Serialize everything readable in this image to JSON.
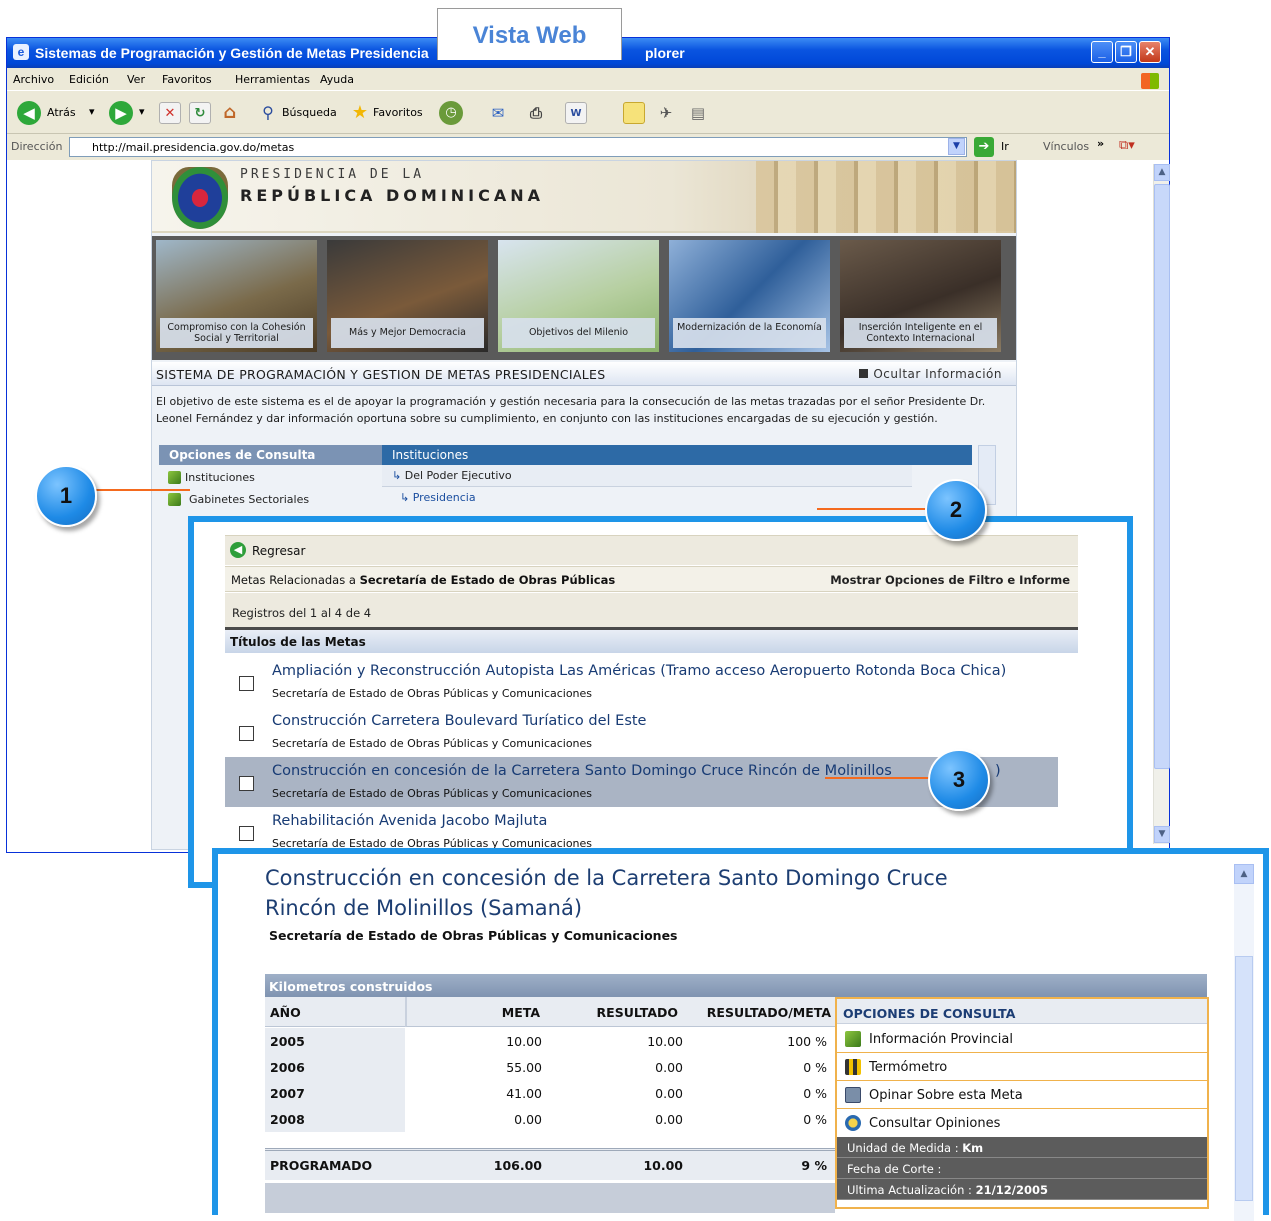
{
  "vista_label": "Vista Web",
  "browser": {
    "title": "Sistemas de Programación y Gestión de Metas Presidencia",
    "title_tail": "plorer",
    "menu": [
      "Archivo",
      "Edición",
      "Ver",
      "Favoritos",
      "Herramientas",
      "Ayuda"
    ],
    "toolbar": {
      "back": "Atrás",
      "search": "Búsqueda",
      "favorites": "Favoritos"
    },
    "address_label": "Dirección",
    "address_url": "http://mail.presidencia.gov.do/metas",
    "go_label": "Ir",
    "links_label": "Vínculos"
  },
  "page": {
    "header_top": "PRESIDENCIA DE LA",
    "header_bottom": "REPÚBLICA DOMINICANA",
    "banners": [
      "Compromiso con la Cohesión Social y Territorial",
      "Más y Mejor Democracia",
      "Objetivos del Milenio",
      "Modernización de la Economía",
      "Inserción Inteligente en el Contexto Internacional"
    ],
    "system_title": "SISTEMA DE PROGRAMACIÓN Y GESTION DE METAS PRESIDENCIALES",
    "hide_info": "Ocultar Información",
    "description": "El objetivo de este sistema es el de apoyar la programación y gestión necesaria para la consecución de las metas trazadas por el señor Presidente Dr. Leonel Fernández y dar información oportuna sobre su cumplimiento, en conjunto con las instituciones encargadas de su ejecución y gestión.",
    "sidebar_title": "Opciones de Consulta",
    "sidebar_items": [
      "Instituciones",
      "Gabinetes Sectoriales"
    ],
    "inst_title": "Instituciones",
    "inst_items": [
      "Del Poder Ejecutivo",
      "Presidencia"
    ]
  },
  "panel2": {
    "back": "Regresar",
    "related_prefix": "Metas Relacionadas a ",
    "related_entity": "Secretaría de Estado de Obras Públicas",
    "filter_link": "Mostrar Opciones de Filtro e Informe",
    "records": "Registros del 1 al 4 de 4",
    "titles_header": "Títulos de las Metas",
    "metas": [
      {
        "title": "Ampliación y Reconstrucción Autopista Las Américas (Tramo acceso Aeropuerto Rotonda Boca Chica)",
        "sub": "Secretaría de Estado de Obras Públicas y Comunicaciones"
      },
      {
        "title": "Construcción Carretera Boulevard Turíatico del Este",
        "sub": "Secretaría de Estado de Obras Públicas y Comunicaciones"
      },
      {
        "title": "Construcción en concesión de la Carretera Santo Domingo Cruce Rincón de Molinillos",
        "sub": "Secretaría de Estado de Obras Públicas y Comunicaciones",
        "title_end": ")"
      },
      {
        "title": "Rehabilitación Avenida Jacobo Majluta",
        "sub": "Secretaría de Estado de Obras Públicas y Comunicaciones"
      }
    ]
  },
  "panel3": {
    "title_line1": "Construcción en concesión de la Carretera Santo Domingo Cruce",
    "title_line2": "Rincón de Molinillos (Samaná)",
    "subtitle": "Secretaría de Estado de Obras Públicas y Comunicaciones",
    "table_caption": "Kilometros construidos",
    "headers": [
      "AÑO",
      "META",
      "RESULTADO",
      "RESULTADO/META"
    ],
    "rows": [
      {
        "year": "2005",
        "meta": "10.00",
        "resultado": "10.00",
        "ratio": "100 %"
      },
      {
        "year": "2006",
        "meta": "55.00",
        "resultado": "0.00",
        "ratio": "0 %"
      },
      {
        "year": "2007",
        "meta": "41.00",
        "resultado": "0.00",
        "ratio": "0 %"
      },
      {
        "year": "2008",
        "meta": "0.00",
        "resultado": "0.00",
        "ratio": "0 %"
      }
    ],
    "total": {
      "label": "PROGRAMADO",
      "meta": "106.00",
      "resultado": "10.00",
      "ratio": "9 %"
    },
    "options_title": "OPCIONES DE CONSULTA",
    "options": [
      "Información Provincial",
      "Termómetro",
      "Opinar Sobre esta Meta",
      "Consultar Opiniones"
    ],
    "unit_label": "Unidad de Medida :",
    "unit_value": "Km",
    "cut_label": "Fecha de Corte :",
    "cut_value": "",
    "update_label": "Ultima Actualización :",
    "update_value": "21/12/2005"
  },
  "callouts": [
    "1",
    "2",
    "3"
  ],
  "colors": {
    "callout": "#1e8ae6",
    "connector": "#f46a1e",
    "frame": "#1e95e8"
  }
}
